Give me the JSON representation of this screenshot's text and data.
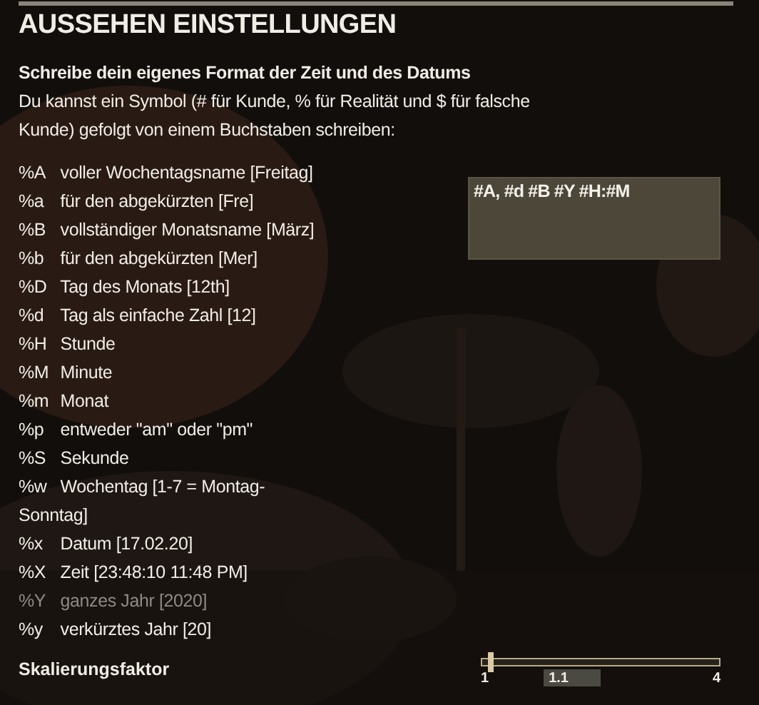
{
  "title": "AUSSEHEN EINSTELLUNGEN",
  "heading": "Schreibe dein eigenes Format der Zeit und des Datums",
  "description": "Du kannst ein Symbol (# für Kunde, % für Realität und $ für falsche Kunde) gefolgt von einem Buchstaben schreiben:",
  "format_codes": [
    {
      "code": "%A",
      "text": "voller Wochentagsname [Freitag]",
      "dimmed": false
    },
    {
      "code": "%a",
      "text": "für den abgekürzten [Fre]",
      "dimmed": false
    },
    {
      "code": "%B",
      "text": "vollständiger Monatsname [März]",
      "dimmed": false
    },
    {
      "code": "%b",
      "text": "für den abgekürzten [Mer]",
      "dimmed": false
    },
    {
      "code": "%D",
      "text": "Tag des Monats [12th]",
      "dimmed": false
    },
    {
      "code": "%d",
      "text": "Tag als einfache Zahl [12]",
      "dimmed": false
    },
    {
      "code": "%H",
      "text": "Stunde",
      "dimmed": false
    },
    {
      "code": "%M",
      "text": "Minute",
      "dimmed": false
    },
    {
      "code": "%m",
      "text": "Monat",
      "dimmed": false
    },
    {
      "code": "%p",
      "text": "entweder \"am\" oder \"pm\"",
      "dimmed": false
    },
    {
      "code": "%S",
      "text": "Sekunde",
      "dimmed": false
    },
    {
      "code": "%w",
      "text": "Wochentag [1-7 = Montag-Sonntag]",
      "dimmed": false
    },
    {
      "code": "%x",
      "text": "Datum [17.02.20]",
      "dimmed": false
    },
    {
      "code": "%X",
      "text": "Zeit [23:48:10  11:48 PM]",
      "dimmed": false
    },
    {
      "code": "%Y",
      "text": "ganzes Jahr [2020]",
      "dimmed": true
    },
    {
      "code": "%y",
      "text": "verkürztes Jahr [20]",
      "dimmed": false
    }
  ],
  "format_field": {
    "value": "#A, #d #B #Y #H:#M"
  },
  "scale": {
    "label": "Skalierungsfaktor",
    "level": 0.033,
    "min": "1",
    "max": "4",
    "value": "1.1"
  }
}
